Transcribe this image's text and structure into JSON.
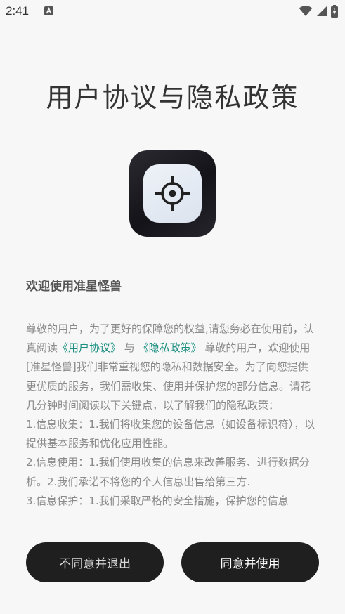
{
  "status_bar": {
    "time": "2:41"
  },
  "page": {
    "title": "用户协议与隐私政策",
    "welcome": "欢迎使用准星怪兽"
  },
  "body": {
    "part1": "尊敬的用户，为了更好的保障您的权益,请您务必在使用前，认真阅读",
    "user_agreement_link": "《用户协议》",
    "and": " 与 ",
    "privacy_link": "《隐私政策》",
    "part2": " 尊敬的用户，欢迎使用[准星怪兽]我们非常重视您的隐私和数据安全。为了向您提供更优质的服务，我们需收集、使用并保护您的部分信息。请花几分钟时间阅读以下关键点，以了解我们的隐私政策：",
    "item1": "1.信息收集：1.我们将收集您的设备信息（如设备标识符），以提供基本服务和优化应用性能。",
    "item2": "2.信息使用：1.我们使用收集的信息来改善服务、进行数据分析。2.我们承诺不将您的个人信息出售给第三方.",
    "item3": "3.信息保护：1.我们采取严格的安全措施，保护您的信息"
  },
  "buttons": {
    "decline_label": "不同意并退出",
    "agree_label": "同意并使用"
  },
  "colors": {
    "link": "#1b8f80",
    "button_bg": "#1f1f1f",
    "background": "#f7f7f7"
  }
}
